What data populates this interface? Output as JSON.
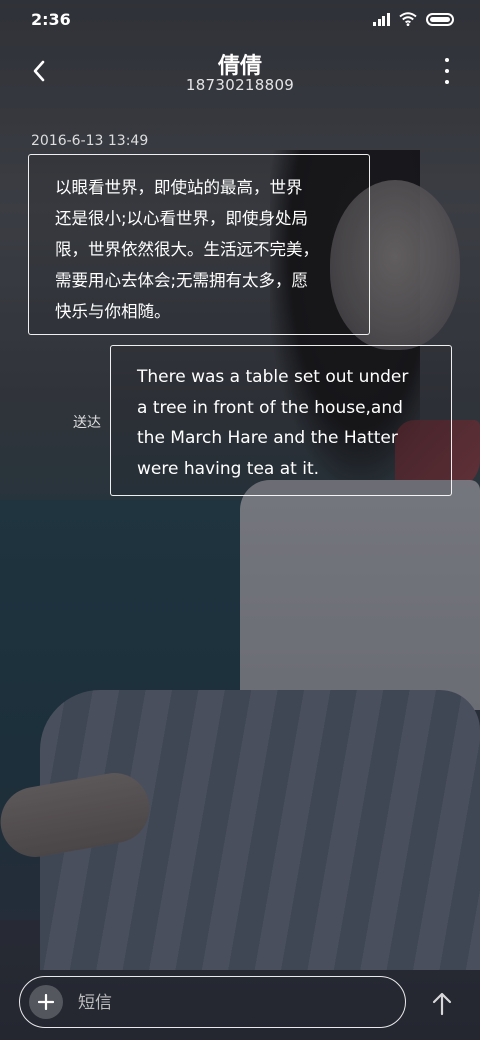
{
  "status_bar": {
    "time": "2:36",
    "icons": [
      "signal-icon",
      "wifi-icon",
      "battery-icon"
    ]
  },
  "header": {
    "back_icon": "chevron-left-icon",
    "contact_name": "倩倩",
    "contact_number": "18730218809",
    "more_icon": "more-vertical-icon"
  },
  "conversation": {
    "date": "2016-6-13 13:49",
    "messages": [
      {
        "direction": "incoming",
        "lines": [
          "以眼看世界，即使站的最高，世界",
          "还是很小;以心看世界，即使身处局",
          "限，世界依然很大。生活远不完美，",
          "需要用心去体会;无需拥有太多，愿",
          "快乐与你相随。"
        ]
      },
      {
        "direction": "outgoing",
        "status": "送达",
        "lines": [
          "There was a table set out under",
          "a tree in front of the house,and",
          "the March Hare and the Hatter",
          "were having tea at it."
        ]
      }
    ]
  },
  "composer": {
    "add_icon": "plus-icon",
    "placeholder": "短信",
    "send_icon": "arrow-up-icon"
  },
  "colors": {
    "text": "#ffffff",
    "muted_text": "#dddddd",
    "bubble_border": "#ffffff"
  }
}
